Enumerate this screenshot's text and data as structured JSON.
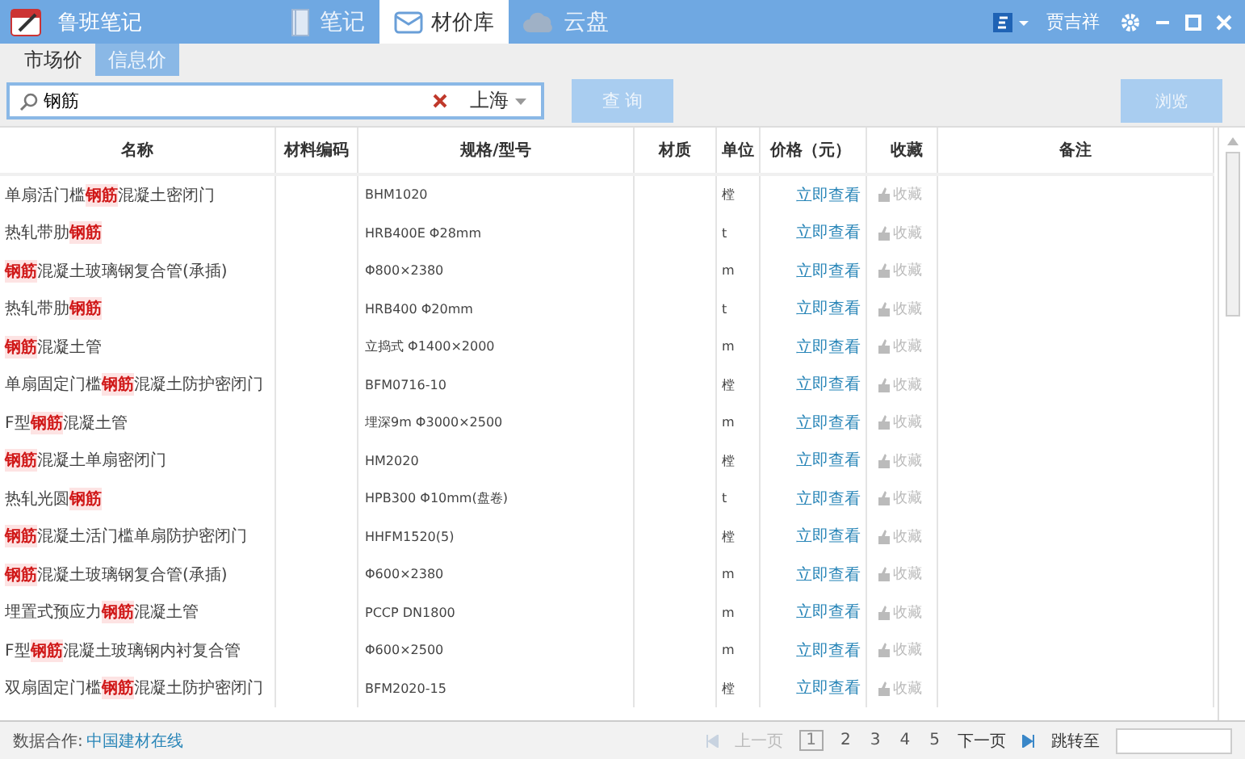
{
  "app": {
    "title": "鲁班笔记"
  },
  "nav_tabs": [
    {
      "label": "笔记",
      "kind": "book",
      "selected": false
    },
    {
      "label": "材价库",
      "kind": "mail",
      "selected": true
    },
    {
      "label": "云盘",
      "kind": "cloud",
      "selected": false
    }
  ],
  "user": {
    "name": "贾吉祥"
  },
  "price_tabs": [
    {
      "label": "市场价",
      "selected": false
    },
    {
      "label": "信息价",
      "selected": true
    }
  ],
  "search": {
    "value": "钢筋",
    "region": "上海"
  },
  "buttons": {
    "query": "查 询",
    "browse": "浏览"
  },
  "table": {
    "columns": [
      "名称",
      "材料编码",
      "规格/型号",
      "材质",
      "单位",
      "价格（元）",
      "收藏",
      "备注"
    ],
    "rows": [
      {
        "name": "单扇活门槛**钢筋**混凝土密闭门",
        "spec": "BHM1020",
        "unit": "樘",
        "price": "立即查看",
        "favorite": "收藏"
      },
      {
        "name": "热轧带肋**钢筋**",
        "spec": "HRB400E Φ28mm",
        "unit": "t",
        "price": "立即查看",
        "favorite": "收藏"
      },
      {
        "name": "**钢筋**混凝土玻璃钢复合管(承插)",
        "spec": "Φ800×2380",
        "unit": "m",
        "price": "立即查看",
        "favorite": "收藏"
      },
      {
        "name": "热轧带肋**钢筋**",
        "spec": "HRB400 Φ20mm",
        "unit": "t",
        "price": "立即查看",
        "favorite": "收藏"
      },
      {
        "name": "**钢筋**混凝土管",
        "spec": "立捣式 Φ1400×2000",
        "unit": "m",
        "price": "立即查看",
        "favorite": "收藏"
      },
      {
        "name": "单扇固定门槛**钢筋**混凝土防护密闭门",
        "spec": "BFM0716-10",
        "unit": "樘",
        "price": "立即查看",
        "favorite": "收藏"
      },
      {
        "name": "F型**钢筋**混凝土管",
        "spec": "埋深9m Φ3000×2500",
        "unit": "m",
        "price": "立即查看",
        "favorite": "收藏"
      },
      {
        "name": "**钢筋**混凝土单扇密闭门",
        "spec": "HM2020",
        "unit": "樘",
        "price": "立即查看",
        "favorite": "收藏"
      },
      {
        "name": "热轧光圆**钢筋**",
        "spec": "HPB300 Φ10mm(盘卷)",
        "unit": "t",
        "price": "立即查看",
        "favorite": "收藏"
      },
      {
        "name": "**钢筋**混凝土活门槛单扇防护密闭门",
        "spec": "HHFM1520(5)",
        "unit": "樘",
        "price": "立即查看",
        "favorite": "收藏"
      },
      {
        "name": "**钢筋**混凝土玻璃钢复合管(承插)",
        "spec": "Φ600×2380",
        "unit": "m",
        "price": "立即查看",
        "favorite": "收藏"
      },
      {
        "name": "埋置式预应力**钢筋**混凝土管",
        "spec": "PCCP DN1800",
        "unit": "m",
        "price": "立即查看",
        "favorite": "收藏"
      },
      {
        "name": "F型**钢筋**混凝土玻璃钢内衬复合管",
        "spec": "Φ600×2500",
        "unit": "m",
        "price": "立即查看",
        "favorite": "收藏"
      },
      {
        "name": "双扇固定门槛**钢筋**混凝土防护密闭门",
        "spec": "BFM2020-15",
        "unit": "樘",
        "price": "立即查看",
        "favorite": "收藏"
      }
    ]
  },
  "status_bar": {
    "credit_label": "数据合作:",
    "credit_link": "中国建材在线",
    "pager": {
      "prev": "上一页",
      "next": "下一页",
      "prev_disabled": true,
      "pages": [
        {
          "label": "1",
          "selected": true
        },
        {
          "label": "2",
          "selected": false
        },
        {
          "label": "3",
          "selected": false
        },
        {
          "label": "4",
          "selected": false
        },
        {
          "label": "5",
          "selected": false
        }
      ],
      "jump_label": "跳转至"
    }
  }
}
